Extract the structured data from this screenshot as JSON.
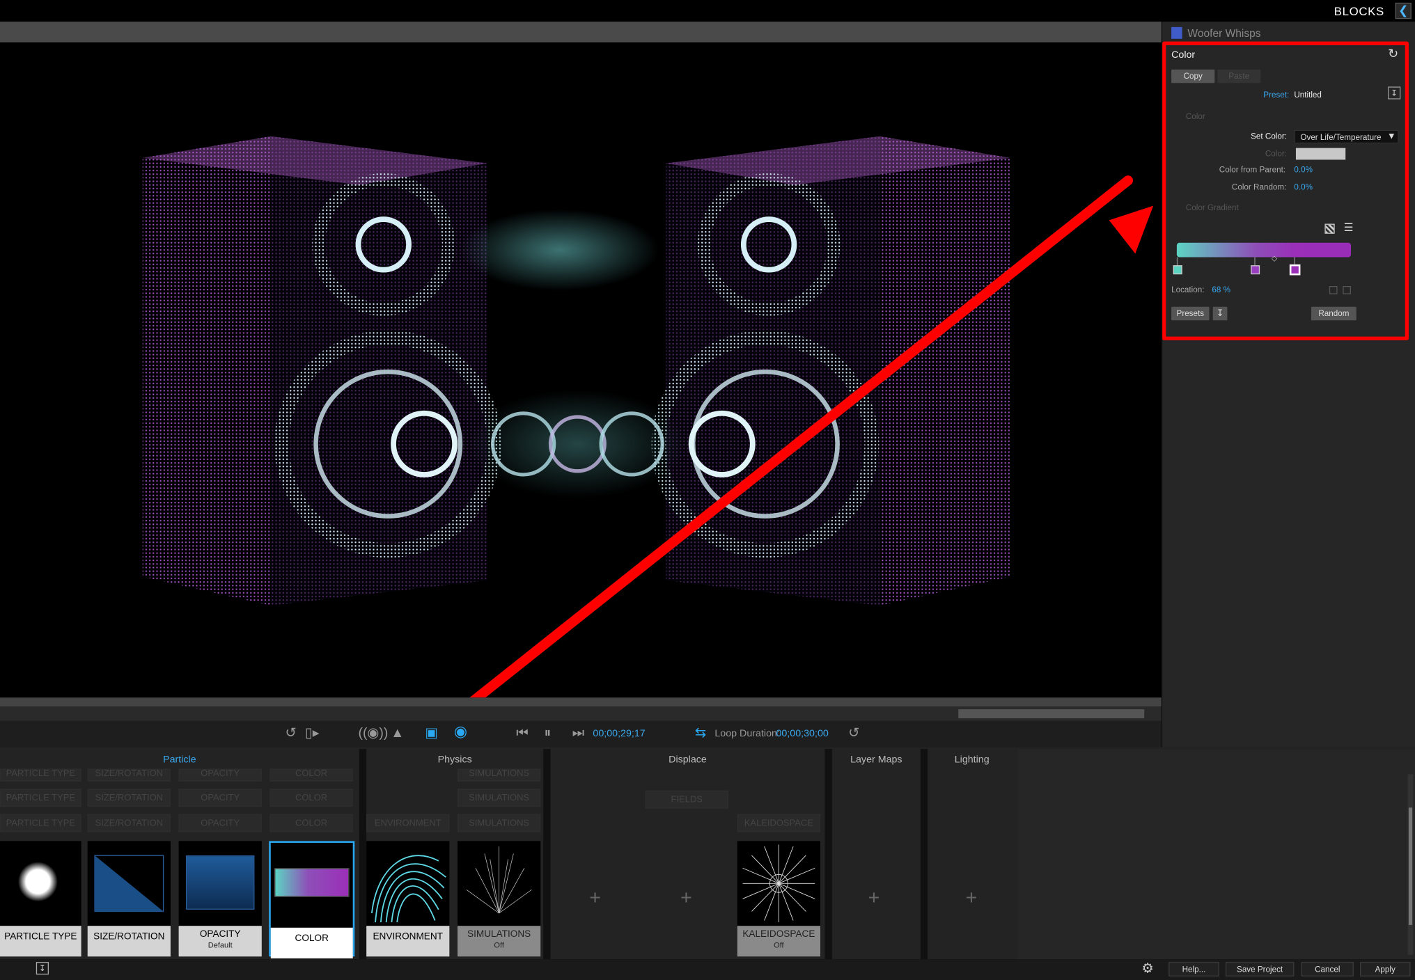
{
  "topbar": {
    "blocks_label": "BLOCKS",
    "collapse_icon": "chevron-left-icon"
  },
  "transport": {
    "time_current": "00;00;29;17",
    "loop_label": "Loop Duration:",
    "loop_value": "00;00;30;00"
  },
  "side": {
    "layer_name": "Woofer Whisps",
    "layer_color": "#3f5cc9",
    "section_title": "Color",
    "copy_label": "Copy",
    "paste_label": "Paste",
    "preset_label": "Preset:",
    "preset_value": "Untitled",
    "color_group": "Color",
    "set_color_label": "Set Color:",
    "set_color_value": "Over Life/Temperature",
    "color_label": "Color:",
    "color_from_parent_label": "Color from Parent:",
    "color_from_parent_value": "0.0%",
    "color_random_label": "Color Random:",
    "color_random_value": "0.0%",
    "gradient_group": "Color Gradient",
    "location_label": "Location:",
    "location_value": "68 %",
    "presets_label": "Presets",
    "random_label": "Random"
  },
  "groups": [
    "Particle",
    "Physics",
    "Displace",
    "Layer Maps",
    "Lighting"
  ],
  "ghost_rows": {
    "particle": [
      "PARTICLE TYPE",
      "SIZE/ROTATION",
      "OPACITY",
      "COLOR"
    ],
    "simulations": "SIMULATIONS",
    "sim_off": "Off",
    "environment": "ENVIRONMENT",
    "fields": "FIELDS",
    "kaleidospace": "KALEIDOSPACE"
  },
  "cards": {
    "particle_type": "PARTICLE TYPE",
    "size_rotation": "SIZE/ROTATION",
    "opacity": "OPACITY",
    "opacity_sub": "Default",
    "color": "COLOR",
    "environment": "ENVIRONMENT",
    "simulations": "SIMULATIONS",
    "simulations_sub": "Off",
    "kaleidospace": "KALEIDOSPACE",
    "kaleidospace_sub": "Off"
  },
  "bottom": {
    "help": "Help...",
    "save_project": "Save Project",
    "cancel": "Cancel",
    "apply": "Apply"
  },
  "colors": {
    "accent": "#2aa8f2",
    "annotation": "#ff0000"
  }
}
